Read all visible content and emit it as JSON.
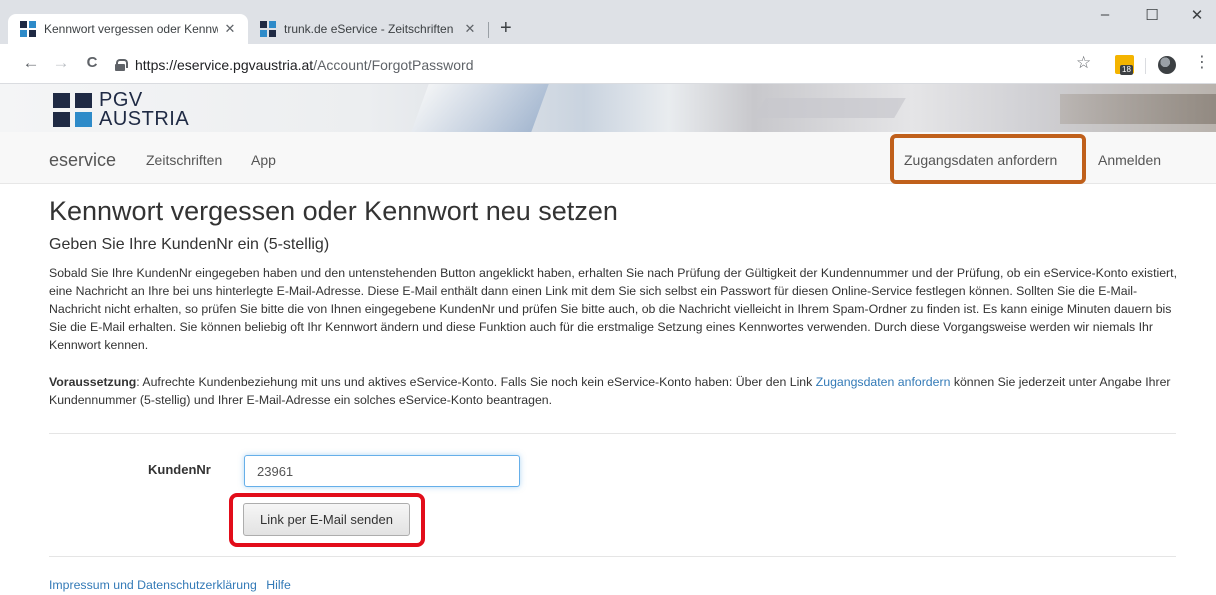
{
  "browser": {
    "tabs": [
      {
        "title": "Kennwort vergessen oder Kennw",
        "active": true
      },
      {
        "title": "trunk.de eService - Zeitschriften",
        "active": false
      }
    ],
    "close_glyph": "✕",
    "new_tab_glyph": "+",
    "window_controls": {
      "minimize": "–",
      "maximize": "☐",
      "close": "✕"
    },
    "nav": {
      "back": "←",
      "forward": "→",
      "reload": "C"
    },
    "url_domain": "https://eservice.pgvaustria.at",
    "url_path": "/Account/ForgotPassword",
    "bookmark_glyph": "☆",
    "extension_badge": "18",
    "menu_glyph": "⋮"
  },
  "logo": {
    "line1": "PGV",
    "line2": "AUSTRIA"
  },
  "nav": {
    "brand": "eservice",
    "links": [
      "Zeitschriften",
      "App"
    ],
    "right_links": [
      "Zugangsdaten anfordern",
      "Anmelden"
    ]
  },
  "main": {
    "title": "Kennwort vergessen oder Kennwort neu setzen",
    "subtitle": "Geben Sie Ihre KundenNr ein (5-stellig)",
    "paragraph": "Sobald Sie Ihre KundenNr eingegeben haben und den untenstehenden Button angeklickt haben, erhalten Sie nach Prüfung der Gültigkeit der Kundennummer und der Prüfung, ob ein eService-Konto existiert, eine Nachricht an Ihre bei uns hinterlegte E-Mail-Adresse. Diese E-Mail enthält dann einen Link mit dem Sie sich selbst ein Passwort für diesen Online-Service festlegen können. Sollten Sie die E-Mail-Nachricht nicht erhalten, so prüfen Sie bitte die von Ihnen eingegebene KundenNr und prüfen Sie bitte auch, ob die Nachricht vielleicht in Ihrem Spam-Ordner zu finden ist. Es kann einige Minuten dauern bis Sie die E-Mail erhalten. Sie können beliebig oft Ihr Kennwort ändern und diese Funktion auch für die erstmalige Setzung eines Kennwortes verwenden. Durch diese Vorgangsweise werden wir niemals Ihr Kennwort kennen.",
    "prereq_label": "Voraussetzung",
    "prereq_text1": ": Aufrechte Kundenbeziehung mit uns und aktives eService-Konto. Falls Sie noch kein eService-Konto haben: Über den Link ",
    "prereq_link": "Zugangsdaten anfordern",
    "prereq_text2": " können Sie jederzeit unter Angabe Ihrer Kundennummer (5-stellig) und Ihrer E-Mail-Adresse ein solches eService-Konto beantragen."
  },
  "form": {
    "label": "KundenNr",
    "value": "23961",
    "button": "Link per E-Mail senden"
  },
  "footer": {
    "links": [
      "Impressum und Datenschutzerklärung",
      "Hilfe"
    ]
  },
  "colors": {
    "link": "#337ab7",
    "highlight_orange": "#c0601b",
    "highlight_red": "#e20d1a",
    "logo_navy": "#1f2a44"
  }
}
